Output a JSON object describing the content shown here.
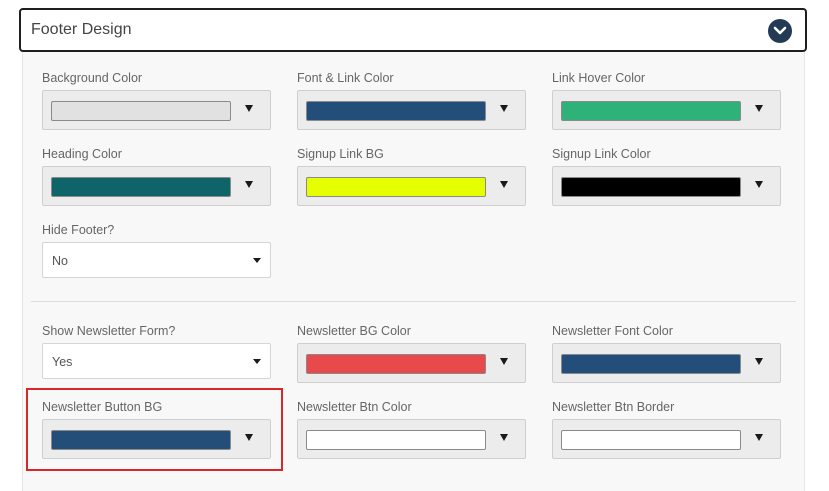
{
  "header": {
    "title": "Footer Design",
    "toggle_icon": "chevron-down-icon"
  },
  "fields": {
    "background_color": {
      "label": "Background Color",
      "color": "#e1e1e1"
    },
    "font_link_color": {
      "label": "Font & Link Color",
      "color": "#234e7a"
    },
    "link_hover_color": {
      "label": "Link Hover Color",
      "color": "#2fb27a"
    },
    "heading_color": {
      "label": "Heading Color",
      "color": "#0e6468"
    },
    "signup_link_bg": {
      "label": "Signup Link BG",
      "color": "#e6ff00"
    },
    "signup_link_color": {
      "label": "Signup Link Color",
      "color": "#000000"
    },
    "hide_footer": {
      "label": "Hide Footer?",
      "value": "No"
    },
    "show_newsletter_form": {
      "label": "Show Newsletter Form?",
      "value": "Yes"
    },
    "newsletter_bg_color": {
      "label": "Newsletter BG Color",
      "color": "#e84a4c"
    },
    "newsletter_font_color": {
      "label": "Newsletter Font Color",
      "color": "#234e7a"
    },
    "newsletter_button_bg": {
      "label": "Newsletter Button BG",
      "color": "#234e7a"
    },
    "newsletter_btn_color": {
      "label": "Newsletter Btn Color",
      "color": "#ffffff"
    },
    "newsletter_btn_border": {
      "label": "Newsletter Btn Border",
      "color": "#ffffff"
    }
  },
  "colors": {
    "header_border": "#1f1f1f",
    "toggle_bg": "#233b54",
    "highlight": "#d9262b"
  }
}
